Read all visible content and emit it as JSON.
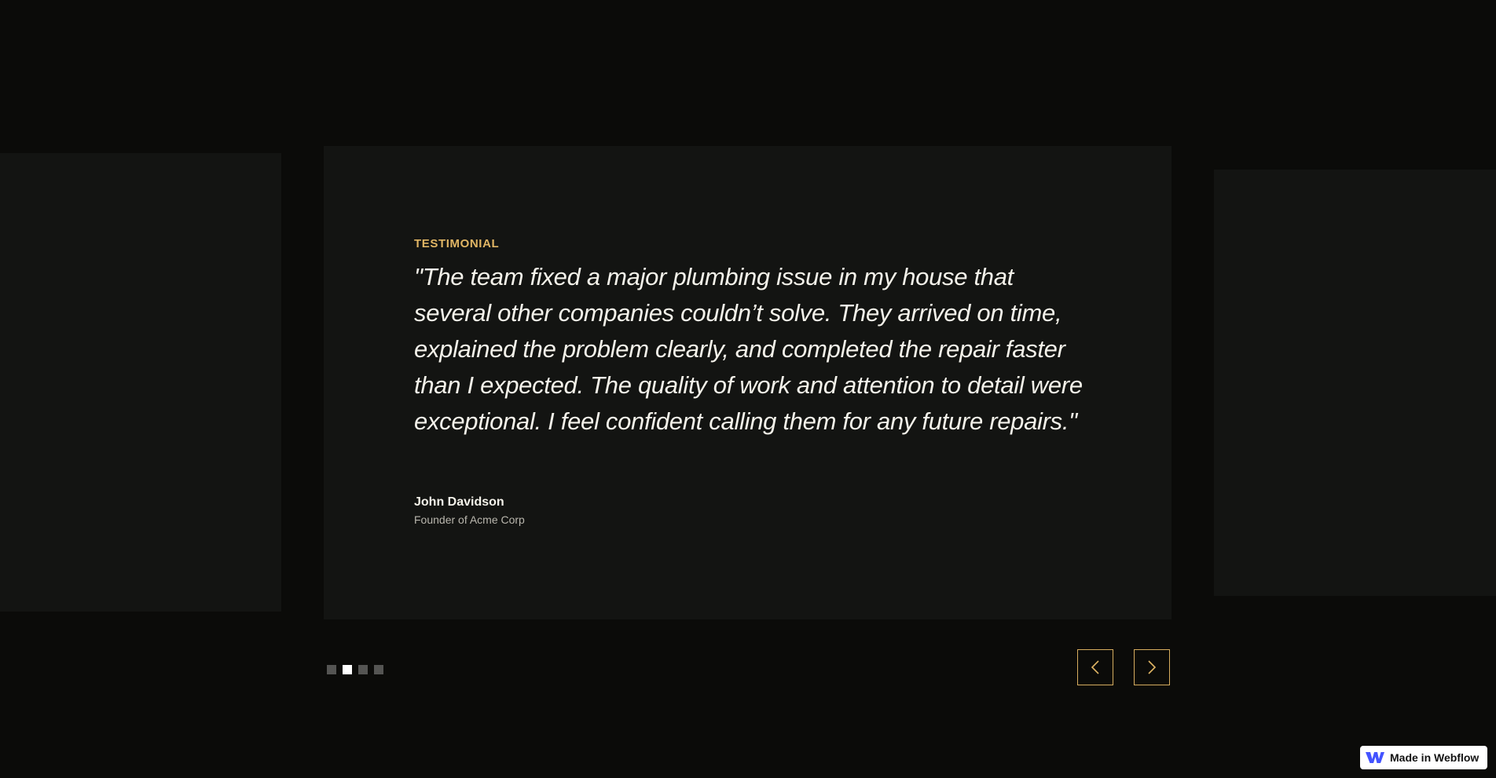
{
  "testimonial": {
    "eyebrow": "TESTIMONIAL",
    "quote": "\"The team fixed a major plumbing issue in my house that several other companies couldn’t solve. They arrived on time, explained the problem clearly, and completed the repair faster than I expected. The quality of work and attention to detail were exceptional. I feel confident calling them for any future repairs.\"",
    "author_name": "John Davidson",
    "author_role": "Founder of Acme Corp"
  },
  "slider": {
    "slide_count": 4,
    "active_slide": 2,
    "prev_icon": "chevron-left-icon",
    "next_icon": "chevron-right-icon"
  },
  "badge": {
    "label": "Made in Webflow",
    "icon": "webflow-logo-icon"
  },
  "colors": {
    "background": "#0b0b09",
    "card": "#131412",
    "accent": "#e0b564",
    "text": "#f4f2ea",
    "dot_inactive": "#555553",
    "dot_active": "#ffffff",
    "badge_logo": "#4353ff"
  }
}
